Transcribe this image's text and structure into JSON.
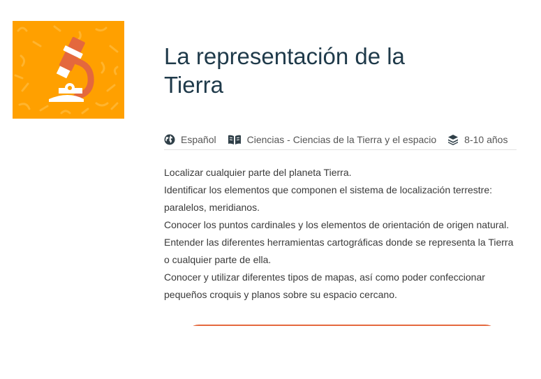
{
  "colors": {
    "thumbnail_bg": "#ffa000",
    "accent": "#e4683d",
    "title": "#1f3a4a"
  },
  "thumbnail": {
    "icon": "microscope-icon"
  },
  "title": "La representación de la Tierra",
  "meta": {
    "language": {
      "icon": "globe-icon",
      "label": "Español"
    },
    "subject": {
      "icon": "book-icon",
      "label": "Ciencias - Ciencias de la Tierra y el espacio"
    },
    "age": {
      "icon": "layers-icon",
      "label": "8-10 años"
    }
  },
  "description": [
    "Localizar cualquier parte del planeta Tierra.",
    "Identificar los elementos que componen el sistema de localización terrestre: paralelos, meridianos.",
    "Conocer los puntos cardinales y los elementos de orientación de origen natural.",
    "Entender las diferentes herramientas cartográficas donde se representa la Tierra o cualquier parte de ella.",
    "Conocer y utilizar diferentes tipos de mapas, así como poder confeccionar pequeños croquis y planos sobre su espacio cercano."
  ]
}
